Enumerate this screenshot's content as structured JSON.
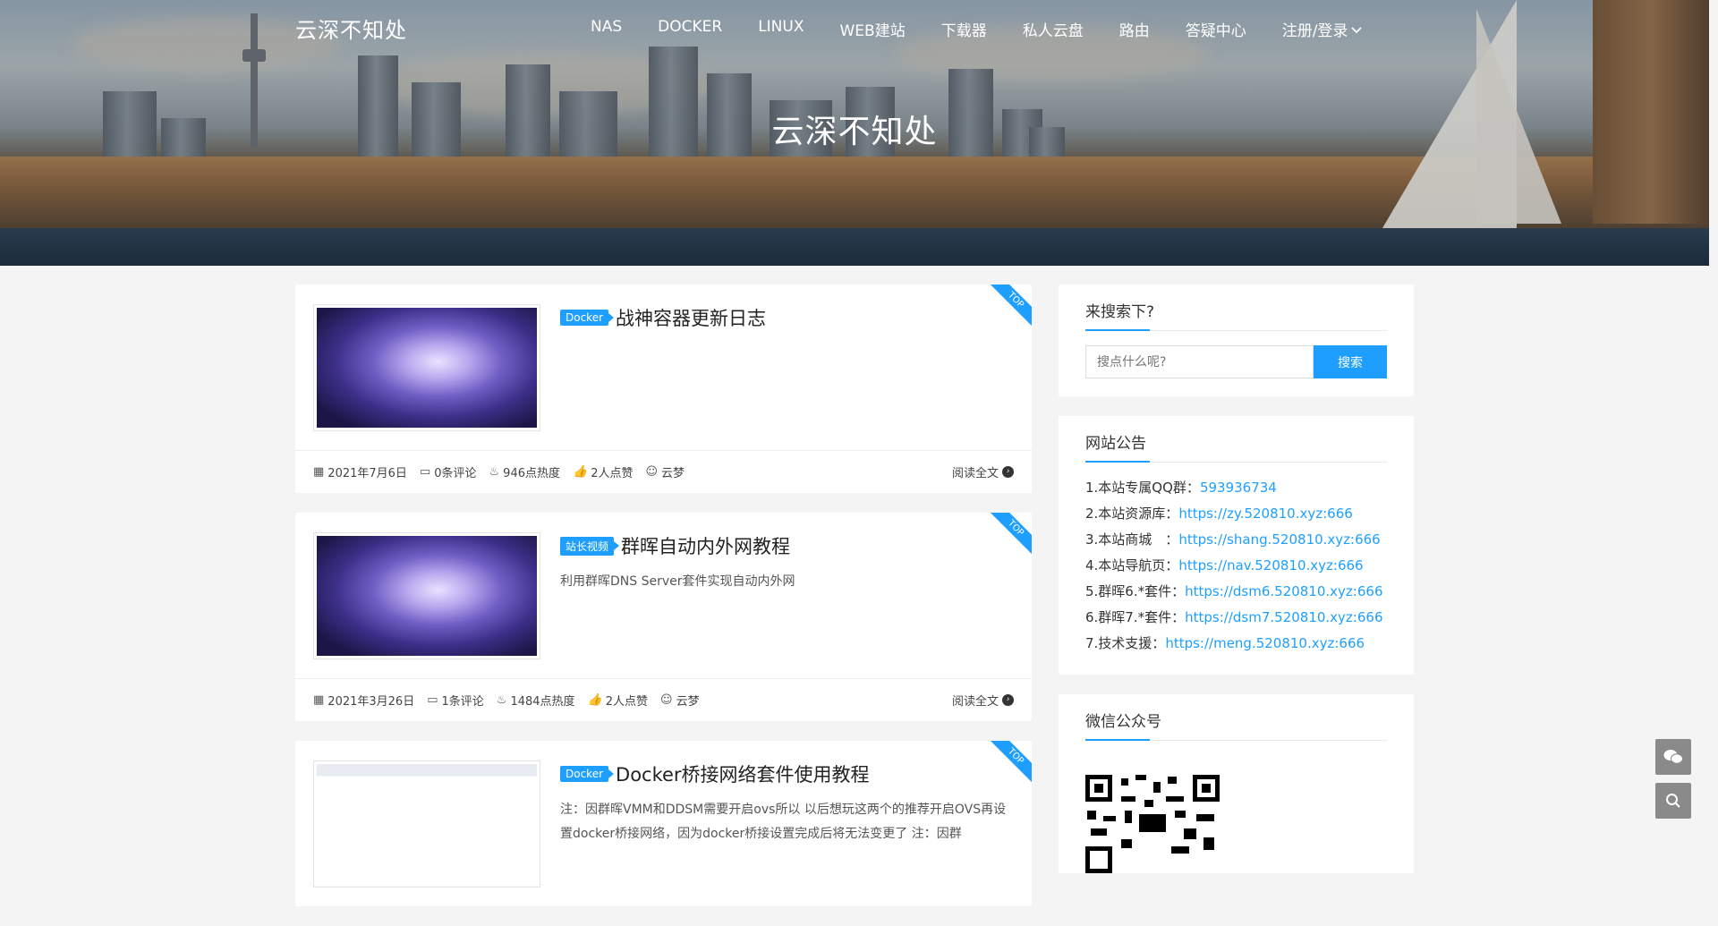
{
  "site": {
    "brand": "云深不知处",
    "hero_title": "云深不知处"
  },
  "nav": {
    "items": [
      "NAS",
      "DOCKER",
      "LINUX",
      "WEB建站",
      "下载器",
      "私人云盘",
      "路由",
      "答疑中心"
    ],
    "login": "注册/登录"
  },
  "posts": [
    {
      "tag": "Docker",
      "title": "战神容器更新日志",
      "desc": "",
      "ribbon": "TOP",
      "date": "2021年7月6日",
      "comments": "0条评论",
      "heat": "946点热度",
      "likes": "2人点赞",
      "author": "云梦",
      "read_more": "阅读全文"
    },
    {
      "tag": "站长视频",
      "title": "群晖自动内外网教程",
      "desc": "利用群晖DNS Server套件实现自动内外网",
      "ribbon": "TOP",
      "date": "2021年3月26日",
      "comments": "1条评论",
      "heat": "1484点热度",
      "likes": "2人点赞",
      "author": "云梦",
      "read_more": "阅读全文"
    },
    {
      "tag": "Docker",
      "title": "Docker桥接网络套件使用教程",
      "desc": "注：因群晖VMM和DDSM需要开启ovs所以 以后想玩这两个的推荐开启OVS再设置docker桥接网络，因为docker桥接设置完成后将无法变更了 注：因群",
      "ribbon": "TOP"
    }
  ],
  "sidebar": {
    "search": {
      "title": "来搜索下?",
      "placeholder": "搜点什么呢?",
      "button": "搜索"
    },
    "notice": {
      "title": "网站公告",
      "lines": [
        {
          "label": "1.本站专属QQ群：",
          "value": "593936734"
        },
        {
          "label": "2.本站资源库：",
          "value": "https://zy.520810.xyz:666"
        },
        {
          "label": "3.本站商城　：",
          "value": "https://shang.520810.xyz:666"
        },
        {
          "label": "4.本站导航页：",
          "value": "https://nav.520810.xyz:666"
        },
        {
          "label": "5.群晖6.*套件：",
          "value": "https://dsm6.520810.xyz:666"
        },
        {
          "label": "6.群晖7.*套件：",
          "value": "https://dsm7.520810.xyz:666"
        },
        {
          "label": "7.技术支援：",
          "value": "https://meng.520810.xyz:666"
        }
      ]
    },
    "wechat": {
      "title": "微信公众号"
    }
  },
  "colors": {
    "accent": "#1e9fff",
    "background": "#f4f4f4"
  },
  "float_icons": [
    "wechat-icon",
    "search-icon"
  ]
}
